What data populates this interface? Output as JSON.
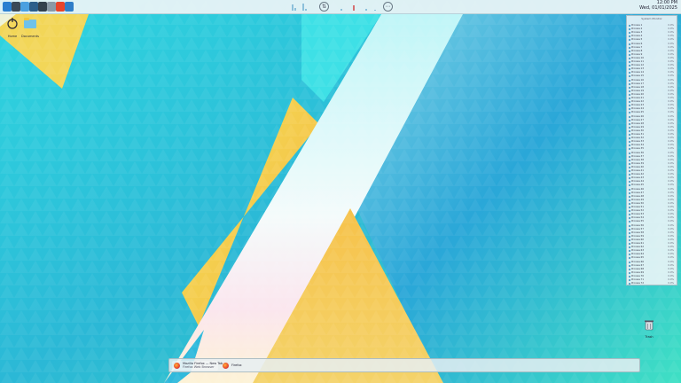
{
  "panel": {
    "launchers": [
      {
        "icon": "app-launcher-icon",
        "color": "#2a7fd0"
      },
      {
        "icon": "terminal-icon",
        "color": "#3b4a57"
      },
      {
        "icon": "files-icon",
        "color": "#4aa0e0"
      },
      {
        "icon": "archive-icon",
        "color": "#2b5e8a"
      },
      {
        "icon": "calculator-icon",
        "color": "#33414d"
      },
      {
        "icon": "settings-icon",
        "color": "#8a99a6"
      },
      {
        "icon": "firefox-icon",
        "color": "#e8452b"
      },
      {
        "icon": "globe-icon",
        "color": "#2f7ec8"
      }
    ],
    "clock": {
      "line1": "12:00 PM",
      "line2": "Wed, 01/01/2025"
    }
  },
  "desktop_icons": [
    {
      "label": "Home",
      "icon": "home-folder-icon"
    },
    {
      "label": "Documents",
      "icon": "folder-icon"
    }
  ],
  "widget": {
    "title": "System Monitor",
    "rows": [
      "Process 1",
      "Process 2",
      "Process 3",
      "Process 4",
      "Process 5",
      "Process 6",
      "Process 7",
      "Process 8",
      "Process 9",
      "Process 10",
      "Process 11",
      "Process 12",
      "Process 13",
      "Process 14",
      "Process 15",
      "Process 16",
      "Process 17",
      "Process 18",
      "Process 19",
      "Process 20",
      "Process 21",
      "Process 22",
      "Process 23",
      "Process 24",
      "Process 25",
      "Process 26",
      "Process 27",
      "Process 28",
      "Process 29",
      "Process 30",
      "Process 31",
      "Process 32",
      "Process 33",
      "Process 34",
      "Process 35",
      "Process 36",
      "Process 37",
      "Process 38",
      "Process 39",
      "Process 40",
      "Process 41",
      "Process 42",
      "Process 43",
      "Process 44",
      "Process 45",
      "Process 46",
      "Process 47",
      "Process 48",
      "Process 49",
      "Process 50",
      "Process 51",
      "Process 52",
      "Process 53",
      "Process 54",
      "Process 55",
      "Process 56",
      "Process 57",
      "Process 58",
      "Process 59",
      "Process 60",
      "Process 61",
      "Process 62",
      "Process 63",
      "Process 64",
      "Process 65",
      "Process 66",
      "Process 67",
      "Process 68",
      "Process 69",
      "Process 70",
      "Process 71",
      "Process 72"
    ],
    "value": "0.0%"
  },
  "taskbar": {
    "tasks": [
      {
        "label": "Mozilla Firefox — New Tab",
        "sublabel": "Firefox Web Browser"
      },
      {
        "label": "Firefox"
      }
    ]
  },
  "trash": {
    "label": "Trash"
  }
}
